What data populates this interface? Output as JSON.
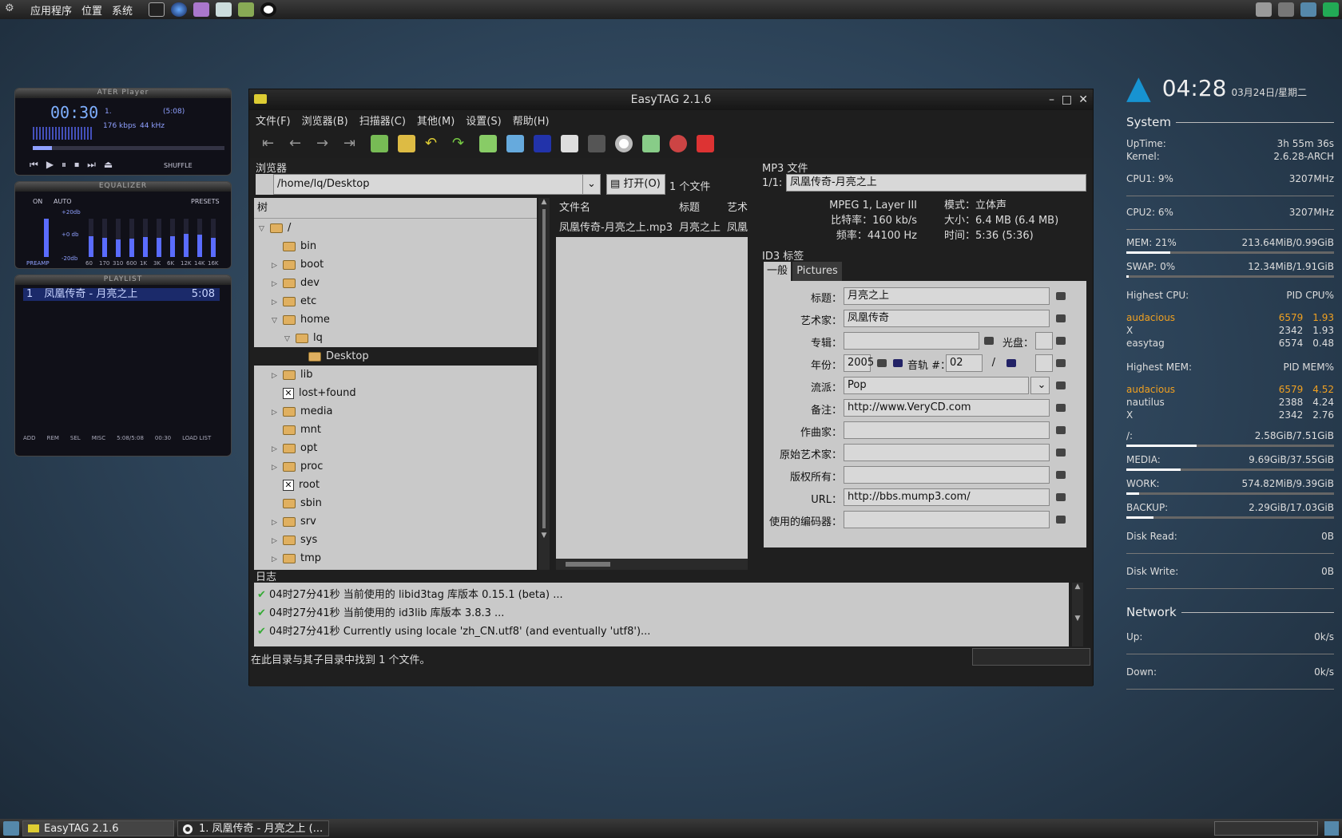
{
  "top_panel": {
    "menus": [
      "应用程序",
      "位置",
      "系统"
    ]
  },
  "xmms": {
    "title": "ATER Player",
    "time": "00:30",
    "track_no": "1.",
    "total": "(5:08)",
    "kbps": "176 kbps",
    "khz": "44 kHz",
    "shuffle": "SHUFFLE",
    "eq_title": "EQUALIZER",
    "eq_on": "ON",
    "eq_auto": "AUTO",
    "eq_presets": "PRESETS",
    "eq_db_top": "+20db",
    "eq_db_mid": "+0 db",
    "eq_db_bot": "-20db",
    "eq_preamp": "PREAMP",
    "eq_bands": [
      "60",
      "170",
      "310",
      "600",
      "1K",
      "3K",
      "6K",
      "12K",
      "14K",
      "16K"
    ],
    "eq_levels": [
      0.55,
      0.5,
      0.45,
      0.48,
      0.52,
      0.5,
      0.55,
      0.6,
      0.58,
      0.5
    ],
    "pl_title": "PLAYLIST",
    "pl_items": [
      {
        "no": "1",
        "name": "凤凰传奇 - 月亮之上",
        "len": "5:08"
      }
    ],
    "pl_buttons": [
      "ADD",
      "REM",
      "SEL",
      "MISC",
      "LOAD LIST"
    ],
    "pl_time": "5:08/5:08",
    "pl_cur": "00:30"
  },
  "window": {
    "title": "EasyTAG 2.1.6",
    "menu": [
      "文件(F)",
      "浏览器(B)",
      "扫描器(C)",
      "其他(M)",
      "设置(S)",
      "帮助(H)"
    ],
    "browser_label": "浏览器",
    "path": "/home/lq/Desktop",
    "open_button": "打开(O)",
    "file_count": "1 个文件",
    "tree_header": "树",
    "tree": [
      {
        "name": "/",
        "depth": 0,
        "arrow": "▽",
        "type": "folder",
        "open": true
      },
      {
        "name": "bin",
        "depth": 1,
        "arrow": "",
        "type": "folder"
      },
      {
        "name": "boot",
        "depth": 1,
        "arrow": "▷",
        "type": "folder"
      },
      {
        "name": "dev",
        "depth": 1,
        "arrow": "▷",
        "type": "folder"
      },
      {
        "name": "etc",
        "depth": 1,
        "arrow": "▷",
        "type": "folder"
      },
      {
        "name": "home",
        "depth": 1,
        "arrow": "▽",
        "type": "folder",
        "open": true
      },
      {
        "name": "lq",
        "depth": 2,
        "arrow": "▽",
        "type": "folder",
        "open": true
      },
      {
        "name": "Desktop",
        "depth": 3,
        "arrow": "",
        "type": "folder",
        "selected": true
      },
      {
        "name": "lib",
        "depth": 1,
        "arrow": "▷",
        "type": "folder"
      },
      {
        "name": "lost+found",
        "depth": 1,
        "arrow": "",
        "type": "locked"
      },
      {
        "name": "media",
        "depth": 1,
        "arrow": "▷",
        "type": "folder"
      },
      {
        "name": "mnt",
        "depth": 1,
        "arrow": "",
        "type": "folder"
      },
      {
        "name": "opt",
        "depth": 1,
        "arrow": "▷",
        "type": "folder"
      },
      {
        "name": "proc",
        "depth": 1,
        "arrow": "▷",
        "type": "folder"
      },
      {
        "name": "root",
        "depth": 1,
        "arrow": "",
        "type": "locked"
      },
      {
        "name": "sbin",
        "depth": 1,
        "arrow": "",
        "type": "folder"
      },
      {
        "name": "srv",
        "depth": 1,
        "arrow": "▷",
        "type": "folder"
      },
      {
        "name": "sys",
        "depth": 1,
        "arrow": "▷",
        "type": "folder"
      },
      {
        "name": "tmp",
        "depth": 1,
        "arrow": "▷",
        "type": "folder"
      }
    ],
    "file_cols": [
      "文件名",
      "标题",
      "艺术"
    ],
    "files": [
      {
        "name": "凤凰传奇-月亮之上.mp3",
        "title": "月亮之上",
        "artist": "凤凰"
      }
    ],
    "mp3_label": "MP3 文件",
    "mp3_index": "1/1:",
    "mp3_name": "凤凰传奇-月亮之上",
    "mp3_info_left": [
      "MPEG 1, Layer III",
      "比特率：160 kb/s",
      "频率：44100 Hz"
    ],
    "mp3_info_right": [
      "模式：立体声",
      "大小：6.4 MB (6.4 MB)",
      "时间：5:36 (5:36)"
    ],
    "id3_label": "ID3 标签",
    "tabs": [
      "一般",
      "Pictures"
    ],
    "tags": [
      {
        "label": "标题：",
        "value": "月亮之上"
      },
      {
        "label": "艺术家：",
        "value": "凤凰传奇"
      },
      {
        "label": "专辑：",
        "value": ""
      },
      {
        "label": "年份：",
        "value": "2005"
      },
      {
        "label": "流派：",
        "value": "Pop"
      },
      {
        "label": "备注：",
        "value": "http://www.VeryCD.com"
      },
      {
        "label": "作曲家：",
        "value": ""
      },
      {
        "label": "原始艺术家：",
        "value": ""
      },
      {
        "label": "版权所有：",
        "value": ""
      },
      {
        "label": "URL：",
        "value": "http://bbs.mump3.com/"
      },
      {
        "label": "使用的编码器：",
        "value": ""
      }
    ],
    "disc_label": "光盘：",
    "track_label": "音轨 #：",
    "track_value": "02",
    "track_sep": "/",
    "log_label": "日志",
    "log": [
      "04时27分41秒  当前使用的 libid3tag 库版本 0.15.1 (beta) ...",
      "04时27分41秒  当前使用的 id3lib 库版本 3.8.3 ...",
      "04时27分41秒  Currently using locale 'zh_CN.utf8' (and eventually 'utf8')..."
    ],
    "status": "在此目录与其子目录中找到 1 个文件。"
  },
  "conky": {
    "time": "04:28",
    "date": "03月24日/星期二",
    "system_title": "System",
    "uptime_label": "UpTime:",
    "uptime": "3h 55m 36s",
    "kernel_label": "Kernel:",
    "kernel": "2.6.28-ARCH",
    "cpu1_label": "CPU1: 9%",
    "cpu1": "3207MHz",
    "cpu2_label": "CPU2: 6%",
    "cpu2": "3207MHz",
    "mem_label": "MEM: 21%",
    "mem": "213.64MiB/0.99GiB",
    "mem_frac": 0.21,
    "swap_label": "SWAP: 0%",
    "swap": "12.34MiB/1.91GiB",
    "swap_frac": 0.01,
    "hcpu_title": "Highest CPU:",
    "hcpu_cols": "PID  CPU%",
    "hcpu": [
      {
        "n": "audacious",
        "pid": "6579",
        "v": "1.93"
      },
      {
        "n": "X",
        "pid": "2342",
        "v": "1.93"
      },
      {
        "n": "easytag",
        "pid": "6574",
        "v": "0.48"
      }
    ],
    "hmem_title": "Highest MEM:",
    "hmem_cols": "PID  MEM%",
    "hmem": [
      {
        "n": "audacious",
        "pid": "6579",
        "v": "4.52"
      },
      {
        "n": "nautilus",
        "pid": "2388",
        "v": "4.24"
      },
      {
        "n": "X",
        "pid": "2342",
        "v": "2.76"
      }
    ],
    "disks": [
      {
        "n": "/:",
        "v": "2.58GiB/7.51GiB",
        "f": 0.34
      },
      {
        "n": "MEDIA:",
        "v": "9.69GiB/37.55GiB",
        "f": 0.26
      },
      {
        "n": "WORK:",
        "v": "574.82MiB/9.39GiB",
        "f": 0.06
      },
      {
        "n": "BACKUP:",
        "v": "2.29GiB/17.03GiB",
        "f": 0.13
      }
    ],
    "dread_label": "Disk Read:",
    "dread": "0B",
    "dwrite_label": "Disk Write:",
    "dwrite": "0B",
    "net_title": "Network",
    "up_label": "Up:",
    "up": "0k/s",
    "down_label": "Down:",
    "down": "0k/s"
  },
  "bottom_panel": {
    "tasks": [
      "EasyTAG 2.1.6",
      "1. 凤凰传奇 - 月亮之上 (..."
    ]
  }
}
